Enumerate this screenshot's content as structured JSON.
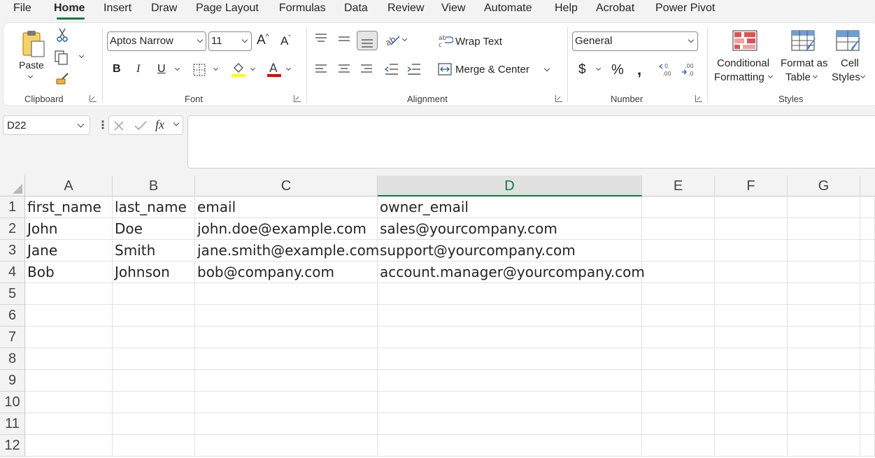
{
  "menu": {
    "file": "File",
    "home": "Home",
    "insert": "Insert",
    "draw": "Draw",
    "page_layout": "Page Layout",
    "formulas": "Formulas",
    "data": "Data",
    "review": "Review",
    "view": "View",
    "automate": "Automate",
    "help": "Help",
    "acrobat": "Acrobat",
    "power_pivot": "Power Pivot"
  },
  "ribbon": {
    "clipboard": {
      "label": "Clipboard",
      "paste": "Paste"
    },
    "font": {
      "label": "Font",
      "font_name": "Aptos Narrow",
      "font_size": "11"
    },
    "alignment": {
      "label": "Alignment",
      "wrap_text": "Wrap Text",
      "merge_center": "Merge & Center"
    },
    "number": {
      "label": "Number",
      "format": "General"
    },
    "styles": {
      "label": "Styles",
      "conditional_1": "Conditional",
      "conditional_2": "Formatting",
      "format_table_1": "Format as",
      "format_table_2": "Table",
      "cell_styles_1": "Cell",
      "cell_styles_2": "Styles"
    },
    "colors": {
      "accent": "#107c41",
      "highlight": "#ffff00",
      "font_color": "#e00000"
    }
  },
  "formula_bar": {
    "name_box": "D22",
    "formula": ""
  },
  "sheet": {
    "columns": [
      "A",
      "B",
      "C",
      "D",
      "E",
      "F",
      "G"
    ],
    "selected_column": "D",
    "rows": [
      "1",
      "2",
      "3",
      "4",
      "5",
      "6",
      "7",
      "8",
      "9",
      "10",
      "11",
      "12"
    ],
    "cells": [
      [
        "first_name",
        "last_name",
        "email",
        "owner_email"
      ],
      [
        "John",
        "Doe",
        "john.doe@example.com",
        "sales@yourcompany.com"
      ],
      [
        "Jane",
        "Smith",
        "jane.smith@example.com",
        "support@yourcompany.com"
      ],
      [
        "Bob",
        "Johnson",
        "bob@company.com",
        "account.manager@yourcompany.com"
      ]
    ]
  }
}
